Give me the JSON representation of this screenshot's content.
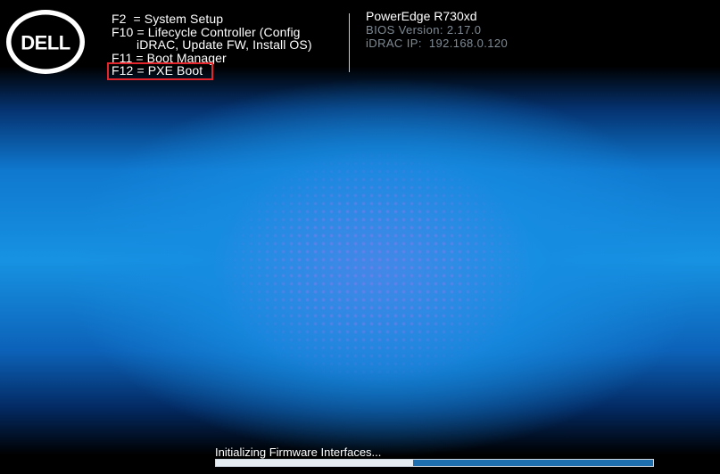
{
  "logo": {
    "text": "DELL",
    "icon": "dell-logo"
  },
  "hotkeys": [
    {
      "key": "F2",
      "label": "= System Setup"
    },
    {
      "key": "F10",
      "label": "= Lifecycle Controller (Config"
    },
    {
      "continuation": "iDRAC, Update FW, Install OS)"
    },
    {
      "key": "F11",
      "label": "= Boot Manager"
    },
    {
      "key": "F12",
      "label": "= PXE Boot",
      "highlighted": true
    }
  ],
  "system_info": {
    "model": "PowerEdge R730xd",
    "bios_version": "BIOS Version: 2.17.0",
    "idrac_ip": "iDRAC IP:  192.168.0.120"
  },
  "status": {
    "message": "Initializing Firmware Interfaces...",
    "progress": 0.45
  },
  "colors": {
    "highlight_border": "#e3262b",
    "progress_track": "#1e6fae",
    "progress_fill": "#e6edf2",
    "background_accent": "#1792e2"
  }
}
